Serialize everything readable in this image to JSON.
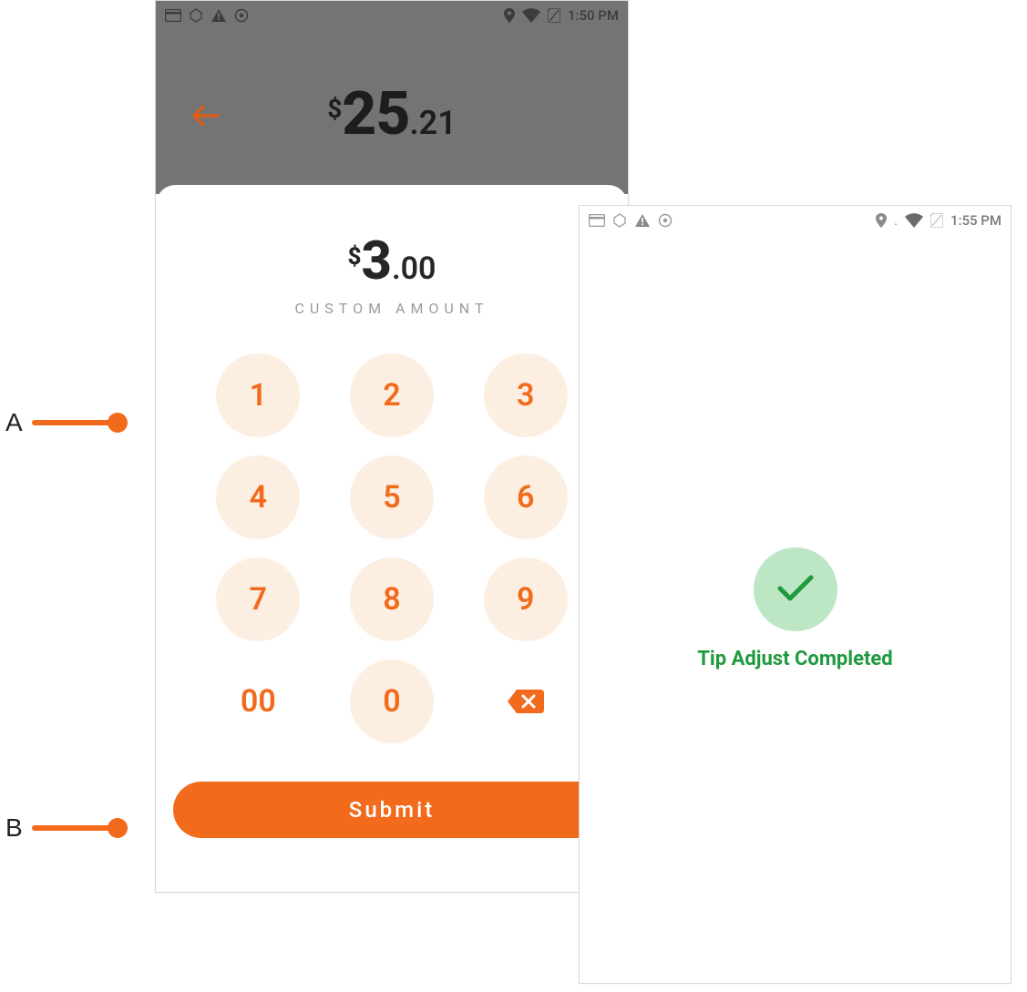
{
  "callouts": {
    "a": "A",
    "b": "B"
  },
  "phoneA": {
    "status": {
      "time": "1:50 PM"
    },
    "total": {
      "currency": "$",
      "whole": "25",
      "cents": ".21"
    },
    "custom": {
      "currency": "$",
      "whole": "3",
      "cents": ".00",
      "label": "CUSTOM AMOUNT"
    },
    "keypad": {
      "k1": "1",
      "k2": "2",
      "k3": "3",
      "k4": "4",
      "k5": "5",
      "k6": "6",
      "k7": "7",
      "k8": "8",
      "k9": "9",
      "k00": "00",
      "k0": "0"
    },
    "submit_label": "Submit"
  },
  "phoneB": {
    "status": {
      "time": "1:55 PM"
    },
    "success_text": "Tip Adjust Completed"
  }
}
